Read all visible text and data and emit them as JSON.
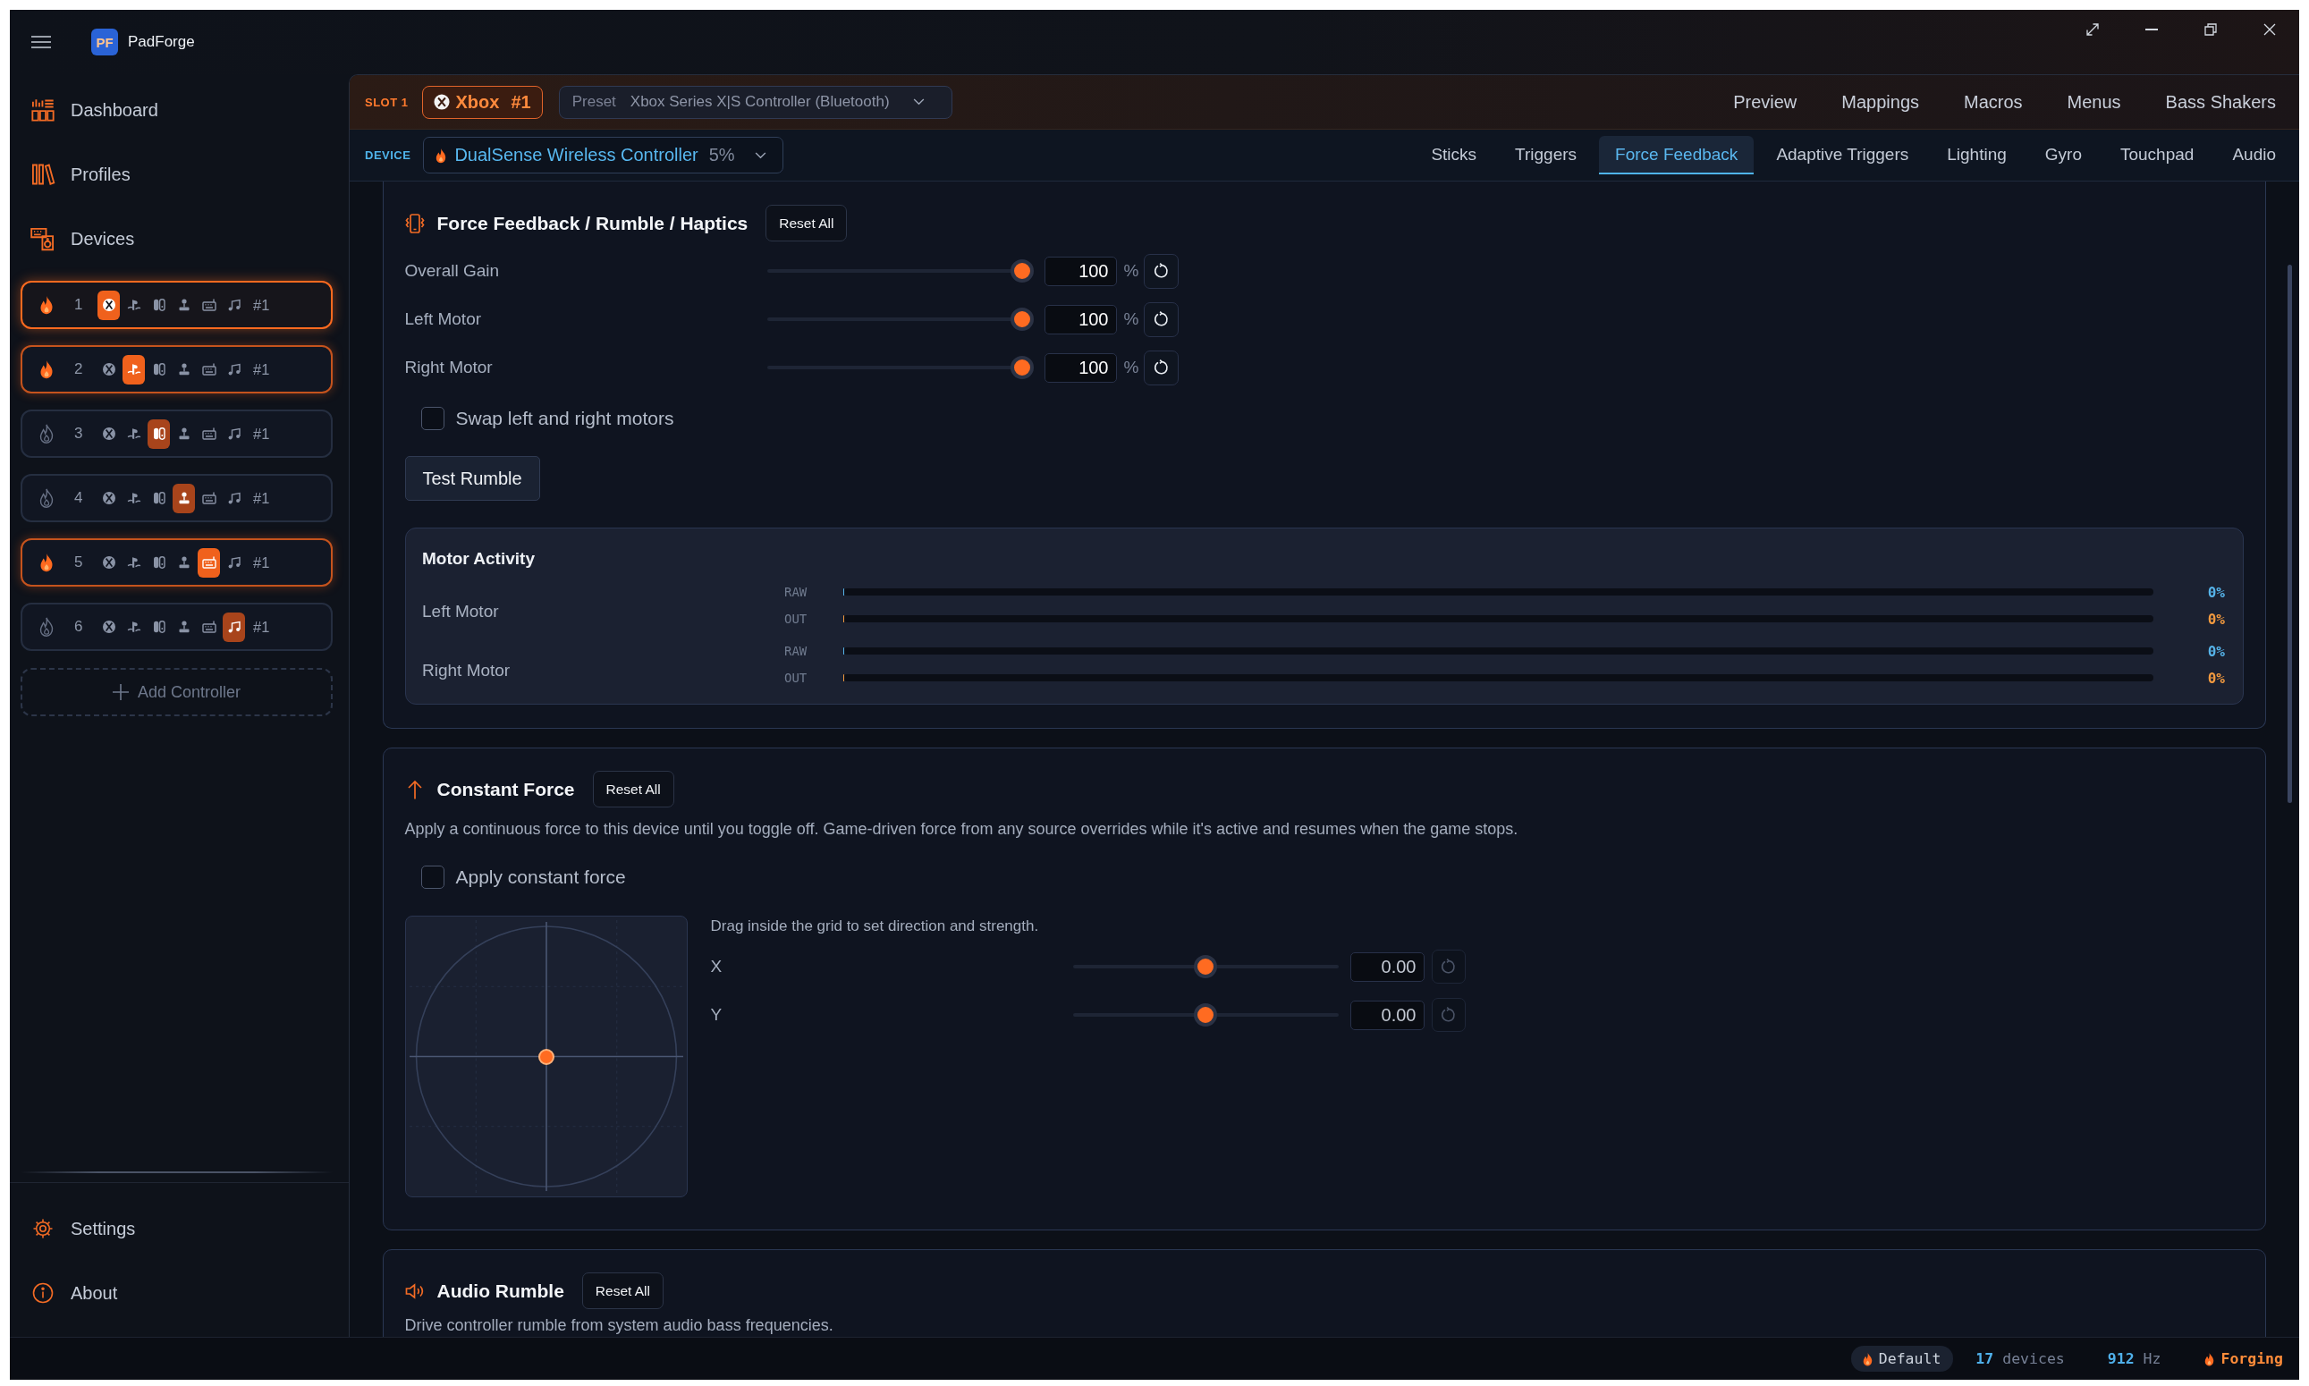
{
  "window": {
    "title": "PadForge",
    "logo": "PF"
  },
  "sidebar": {
    "nav": [
      {
        "label": "Dashboard",
        "selected": false
      },
      {
        "label": "Profiles",
        "selected": false
      },
      {
        "label": "Devices",
        "selected": false
      }
    ],
    "slots": [
      {
        "number": "1",
        "tag": "#1",
        "selected": true,
        "active": true,
        "types": [
          {
            "kind": "xbox",
            "selected": true
          },
          {
            "kind": "playstation",
            "selected": false
          },
          {
            "kind": "switch",
            "selected": false
          },
          {
            "kind": "joystick",
            "selected": false
          },
          {
            "kind": "keyboard",
            "selected": false
          },
          {
            "kind": "audio",
            "selected": false
          }
        ]
      },
      {
        "number": "2",
        "tag": "#1",
        "selected": false,
        "active": true,
        "types": [
          {
            "kind": "xbox",
            "selected": false
          },
          {
            "kind": "playstation",
            "selected": true
          },
          {
            "kind": "switch",
            "selected": false
          },
          {
            "kind": "joystick",
            "selected": false
          },
          {
            "kind": "keyboard",
            "selected": false
          },
          {
            "kind": "audio",
            "selected": false
          }
        ]
      },
      {
        "number": "3",
        "tag": "#1",
        "selected": false,
        "active": false,
        "types": [
          {
            "kind": "xbox",
            "selected": false
          },
          {
            "kind": "playstation",
            "selected": false
          },
          {
            "kind": "switch",
            "selected": true
          },
          {
            "kind": "joystick",
            "selected": false
          },
          {
            "kind": "keyboard",
            "selected": false
          },
          {
            "kind": "audio",
            "selected": false
          }
        ]
      },
      {
        "number": "4",
        "tag": "#1",
        "selected": false,
        "active": false,
        "types": [
          {
            "kind": "xbox",
            "selected": false
          },
          {
            "kind": "playstation",
            "selected": false
          },
          {
            "kind": "switch",
            "selected": false
          },
          {
            "kind": "joystick",
            "selected": true
          },
          {
            "kind": "keyboard",
            "selected": false
          },
          {
            "kind": "audio",
            "selected": false
          }
        ]
      },
      {
        "number": "5",
        "tag": "#1",
        "selected": false,
        "active": true,
        "types": [
          {
            "kind": "xbox",
            "selected": false
          },
          {
            "kind": "playstation",
            "selected": false
          },
          {
            "kind": "switch",
            "selected": false
          },
          {
            "kind": "joystick",
            "selected": false
          },
          {
            "kind": "keyboard",
            "selected": true
          },
          {
            "kind": "audio",
            "selected": false
          }
        ]
      },
      {
        "number": "6",
        "tag": "#1",
        "selected": false,
        "active": false,
        "types": [
          {
            "kind": "xbox",
            "selected": false
          },
          {
            "kind": "playstation",
            "selected": false
          },
          {
            "kind": "switch",
            "selected": false
          },
          {
            "kind": "joystick",
            "selected": false
          },
          {
            "kind": "keyboard",
            "selected": false
          },
          {
            "kind": "audio",
            "selected": true
          }
        ]
      }
    ],
    "add_button": "Add Controller",
    "footer": [
      {
        "label": "Settings",
        "selected": false
      },
      {
        "label": "About",
        "selected": false
      }
    ]
  },
  "header": {
    "slot_label": "SLOT 1",
    "controller": {
      "name": "Xbox",
      "number": "#1"
    },
    "preset": {
      "label": "Preset",
      "value": "Xbox Series X|S Controller (Bluetooth)"
    },
    "nav": [
      {
        "label": "Preview",
        "selected": false
      },
      {
        "label": "Mappings",
        "selected": false
      },
      {
        "label": "Macros",
        "selected": false
      },
      {
        "label": "Menus",
        "selected": false
      },
      {
        "label": "Bass Shakers",
        "selected": false
      }
    ],
    "device_label": "DEVICE",
    "device": {
      "name": "DualSense Wireless Controller",
      "battery": "5%"
    },
    "tabs": [
      {
        "label": "Sticks",
        "selected": false
      },
      {
        "label": "Triggers",
        "selected": false
      },
      {
        "label": "Force Feedback",
        "selected": true
      },
      {
        "label": "Adaptive Triggers",
        "selected": false
      },
      {
        "label": "Lighting",
        "selected": false
      },
      {
        "label": "Gyro",
        "selected": false
      },
      {
        "label": "Touchpad",
        "selected": false
      },
      {
        "label": "Audio",
        "selected": false
      }
    ]
  },
  "force_feedback": {
    "title": "Force Feedback / Rumble / Haptics",
    "reset_label": "Reset All",
    "sliders": [
      {
        "label": "Overall Gain",
        "level": 1,
        "value": "100",
        "unit": "%",
        "reset_disabled": false
      },
      {
        "label": "Left Motor",
        "level": 1,
        "value": "100",
        "unit": "%",
        "reset_disabled": false
      },
      {
        "label": "Right Motor",
        "level": 1,
        "value": "100",
        "unit": "%",
        "reset_disabled": false
      }
    ],
    "swap": {
      "label": "Swap left and right motors",
      "checked": false
    },
    "test_button": "Test Rumble",
    "motor_activity": {
      "title": "Motor Activity",
      "motors": [
        {
          "name": "Left Motor",
          "channels": [
            {
              "kind": "raw",
              "label": "RAW",
              "level": 0,
              "reading": "0%"
            },
            {
              "kind": "out",
              "label": "OUT",
              "level": 0,
              "reading": "0%"
            }
          ]
        },
        {
          "name": "Right Motor",
          "channels": [
            {
              "kind": "raw",
              "label": "RAW",
              "level": 0,
              "reading": "0%"
            },
            {
              "kind": "out",
              "label": "OUT",
              "level": 0,
              "reading": "0%"
            }
          ]
        }
      ]
    }
  },
  "constant_force": {
    "title": "Constant Force",
    "reset_label": "Reset All",
    "description": "Apply a continuous force to this device until you toggle off. Game-driven force from any source overrides while it's active and resumes when the game stops.",
    "apply": {
      "label": "Apply constant force",
      "checked": false
    },
    "hint": "Drag inside the grid to set direction and strength.",
    "axes": [
      {
        "label": "X",
        "level": 0.5,
        "value": "0.00",
        "reset_disabled": true
      },
      {
        "label": "Y",
        "level": 0.5,
        "value": "0.00",
        "reset_disabled": true
      }
    ]
  },
  "audio_rumble": {
    "title": "Audio Rumble",
    "reset_label": "Reset All",
    "description": "Drive controller rumble from system audio bass frequencies."
  },
  "status_bar": {
    "profile": "Default",
    "device_count": "17",
    "device_unit": "devices",
    "rate": "912",
    "rate_unit": "Hz",
    "state": "Forging"
  }
}
